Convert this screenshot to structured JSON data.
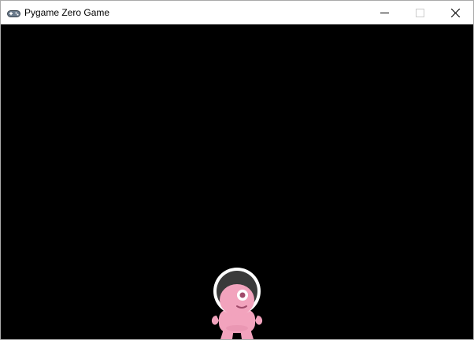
{
  "window": {
    "title": "Pygame Zero Game",
    "icon": "gamepad-icon",
    "controls": [
      "minimize-icon",
      "maximize-icon",
      "close-icon"
    ]
  },
  "game": {
    "background_color": "#000000",
    "sprite": {
      "name": "alien",
      "body_color": "#f2a3bd",
      "helmet_ring_color": "#ffffff",
      "visor_color": "#3a3a3a"
    }
  }
}
